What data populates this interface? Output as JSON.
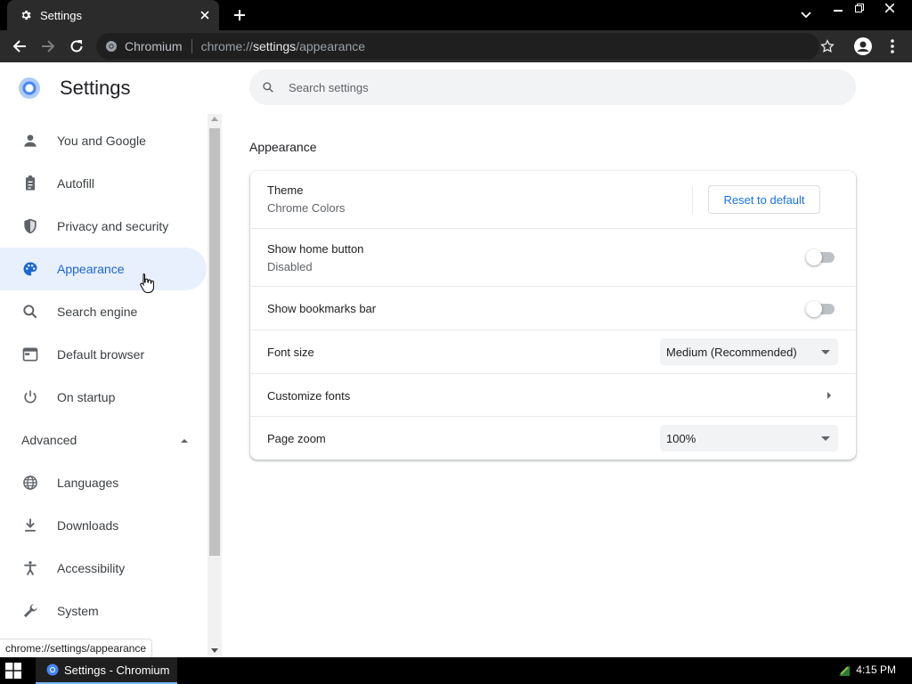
{
  "window": {
    "tab_title": "Settings",
    "tab_icon": "gear-icon"
  },
  "toolbar": {
    "site_chip": "Chromium",
    "url_scheme": "chrome://",
    "url_host": "settings",
    "url_path": "/appearance"
  },
  "sidebar": {
    "title": "Settings",
    "items": [
      {
        "label": "You and Google",
        "icon": "person-icon"
      },
      {
        "label": "Autofill",
        "icon": "clipboard-icon"
      },
      {
        "label": "Privacy and security",
        "icon": "shield-icon"
      },
      {
        "label": "Appearance",
        "icon": "palette-icon",
        "active": true
      },
      {
        "label": "Search engine",
        "icon": "search-icon"
      },
      {
        "label": "Default browser",
        "icon": "browser-icon"
      },
      {
        "label": "On startup",
        "icon": "power-icon"
      }
    ],
    "advanced_label": "Advanced",
    "advanced_items": [
      {
        "label": "Languages",
        "icon": "globe-icon"
      },
      {
        "label": "Downloads",
        "icon": "download-icon"
      },
      {
        "label": "Accessibility",
        "icon": "accessibility-icon"
      },
      {
        "label": "System",
        "icon": "wrench-icon"
      }
    ],
    "status_url": "chrome://settings/appearance"
  },
  "main": {
    "search_placeholder": "Search settings",
    "section_title": "Appearance",
    "theme": {
      "label": "Theme",
      "value": "Chrome Colors",
      "reset_label": "Reset to default"
    },
    "home_button": {
      "label": "Show home button",
      "status": "Disabled",
      "enabled": false
    },
    "bookmarks_bar": {
      "label": "Show bookmarks bar",
      "enabled": false
    },
    "font_size": {
      "label": "Font size",
      "value": "Medium (Recommended)"
    },
    "customize_fonts": {
      "label": "Customize fonts"
    },
    "page_zoom": {
      "label": "Page zoom",
      "value": "100%"
    }
  },
  "taskbar": {
    "app_label": "Settings - Chromium",
    "clock": "4:15 PM"
  },
  "colors": {
    "accent": "#1a73e8",
    "active_nav_bg": "#e8f0fe",
    "chrome_dark": "#2b2b2b"
  }
}
